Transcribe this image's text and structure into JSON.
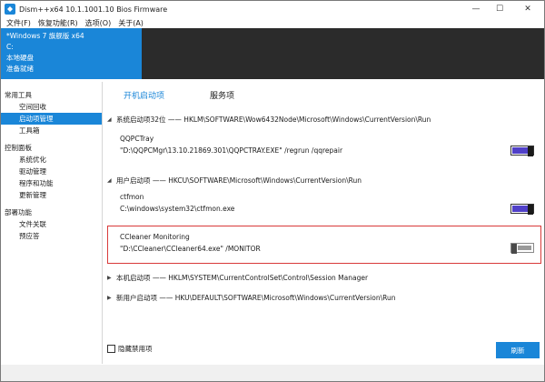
{
  "window": {
    "title": "Dism++x64 10.1.1001.10 Bios Firmware",
    "controls": {
      "minimize": "—",
      "maximize": "☐",
      "close": "✕"
    }
  },
  "menu": [
    "文件(F)",
    "恢复功能(R)",
    "选项(O)",
    "关于(A)"
  ],
  "header": {
    "os": "*Windows 7 旗舰版 x64",
    "drive": "C:",
    "disk": "本地硬盘",
    "status": "准备就绪"
  },
  "sidebar": {
    "groups": [
      {
        "label": "常用工具",
        "items": [
          "空间回收",
          "启动项管理",
          "工具箱"
        ]
      },
      {
        "label": "控制面板",
        "items": [
          "系统优化",
          "驱动管理",
          "程序和功能",
          "更新管理"
        ]
      },
      {
        "label": "部署功能",
        "items": [
          "文件关联",
          "预应答"
        ]
      }
    ],
    "active": "启动项管理"
  },
  "tabs": [
    "开机启动项",
    "服务项"
  ],
  "active_tab": "开机启动项",
  "sections": [
    {
      "label": "系统启动项32位 —— HKLM\\SOFTWARE\\Wow6432Node\\Microsoft\\Windows\\CurrentVersion\\Run",
      "expanded": true
    },
    {
      "label": "用户启动项 —— HKCU\\SOFTWARE\\Microsoft\\Windows\\CurrentVersion\\Run",
      "expanded": true
    },
    {
      "label": "本机启动项 —— HKLM\\SYSTEM\\CurrentControlSet\\Control\\Session Manager",
      "expanded": false
    },
    {
      "label": "新用户启动项 —— HKU\\DEFAULT\\SOFTWARE\\Microsoft\\Windows\\CurrentVersion\\Run",
      "expanded": false
    }
  ],
  "entries": [
    {
      "name": "QQPCTray",
      "command": "\"D:\\QQPCMgr\\13.10.21869.301\\QQPCTRAY.EXE\" /regrun /qqrepair",
      "enabled": true
    },
    {
      "name": "ctfmon",
      "command": "C:\\windows\\system32\\ctfmon.exe",
      "enabled": true
    },
    {
      "name": "CCleaner Monitoring",
      "command": "\"D:\\CCleaner\\CCleaner64.exe\" /MONITOR",
      "enabled": false
    }
  ],
  "footer": {
    "hide_disabled_label": "隐藏禁用项",
    "hide_disabled_checked": false,
    "refresh_label": "刷新"
  },
  "colors": {
    "accent": "#1a86d8",
    "toggle_on": "#5040c8",
    "highlight": "#d93a3a"
  }
}
